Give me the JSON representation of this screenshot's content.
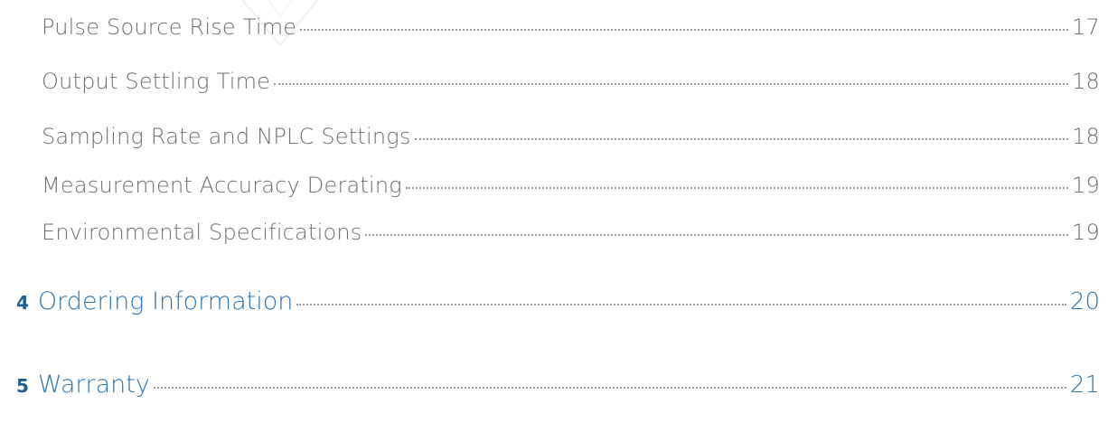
{
  "toc": {
    "sections": [
      {
        "title": "Pulse Source Rise Time",
        "page": "17"
      },
      {
        "title": "Output Settling Time",
        "page": "18"
      },
      {
        "title": "Sampling Rate and NPLC Settings",
        "page": "18"
      },
      {
        "title": "Measurement Accuracy Derating",
        "page": "19"
      },
      {
        "title": "Environmental Specifications",
        "page": "19"
      }
    ],
    "chapters": [
      {
        "number": "4",
        "title": "Ordering Information",
        "page": "20"
      },
      {
        "number": "5",
        "title": "Warranty",
        "page": "21"
      }
    ]
  },
  "colors": {
    "section_text": "#6f6f6f",
    "chapter_text": "#2d74b1",
    "chapter_number": "#1f5d94"
  },
  "icons": {
    "watermark": "logo-watermark-icon"
  }
}
